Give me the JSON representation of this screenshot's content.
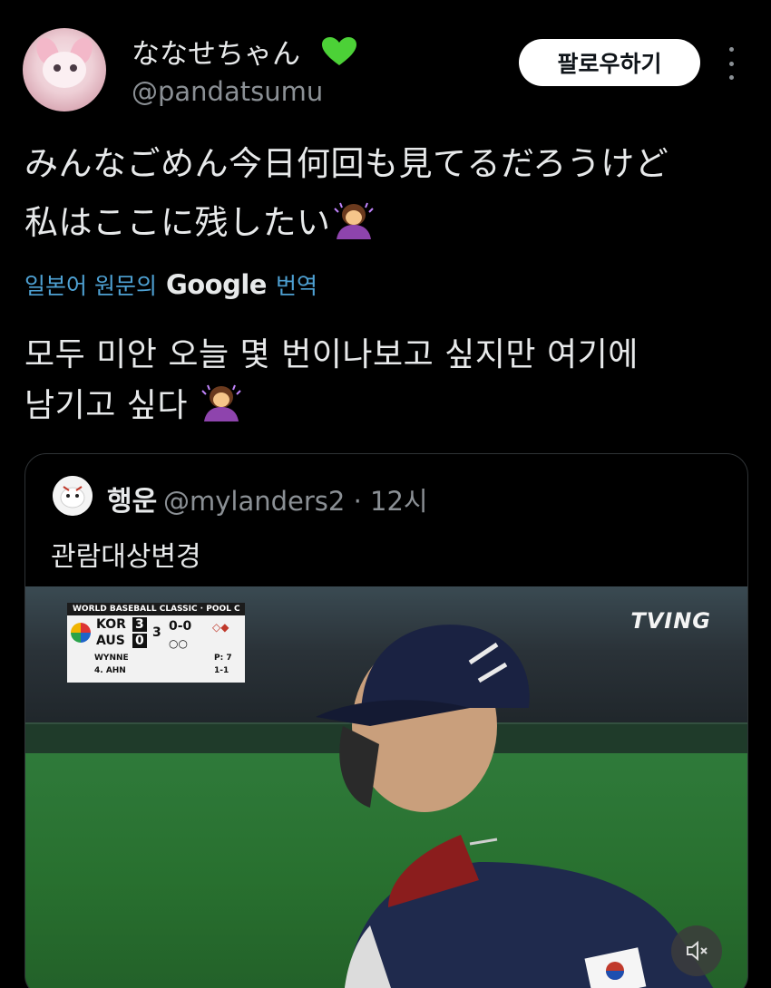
{
  "author": {
    "display_name": "ななせちゃん",
    "handle": "@pandatsumu"
  },
  "follow_label": "팔로우하기",
  "tweet": {
    "line1": "みんなごめん今日何回も見てるだろうけど",
    "line2": "私はここに残したい"
  },
  "translation": {
    "link_label": "일본어 원문의",
    "provider": "Google",
    "action": "번역",
    "line1": "모두 미안 오늘 몇 번이나보고 싶지만 여기에",
    "line2": "남기고 싶다"
  },
  "quoted": {
    "name": "행운",
    "handle_time": "@mylanders2 · 12시",
    "text": "관람대상변경",
    "scorebug": {
      "header": "WORLD BASEBALL CLASSIC · POOL C",
      "team1": "KOR",
      "score1": "3",
      "team2": "AUS",
      "score2": "0",
      "inning": "3",
      "count": "0-0",
      "pitcher": "WYNNE",
      "pitch_count": "P: 7",
      "batter": "4. AHN",
      "batter_stat": "1-1"
    },
    "broadcaster": "TVING"
  },
  "colors": {
    "background": "#000000",
    "link": "#4ea1d3",
    "muted_text": "#8b9095",
    "heart": "#4cd137"
  },
  "icons": [
    "green-heart-icon",
    "more-icon",
    "woman-bowing-emoji",
    "mute-icon"
  ]
}
